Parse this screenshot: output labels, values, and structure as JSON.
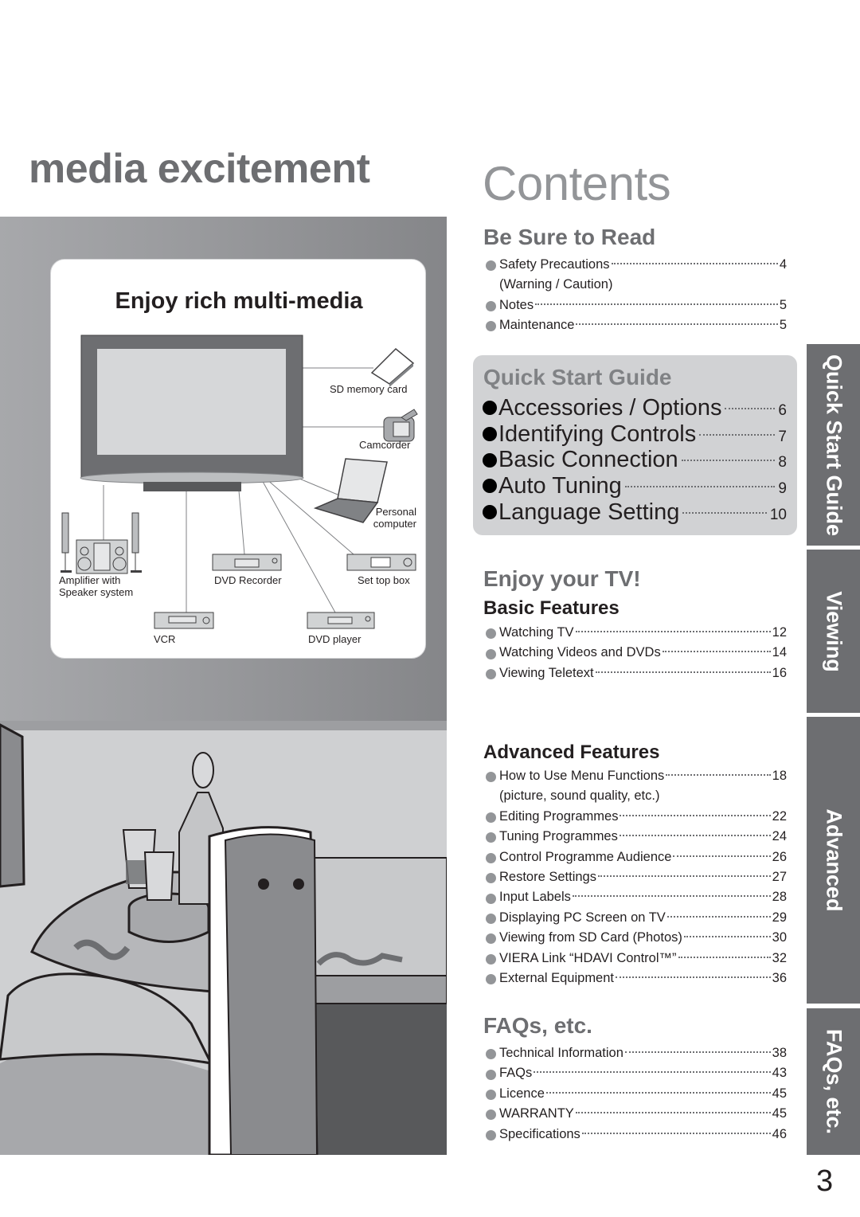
{
  "headline": "media excitement",
  "media_card": {
    "title": "Enjoy rich multi-media",
    "devices": [
      {
        "id": "sd-card",
        "label": "SD memory card"
      },
      {
        "id": "camcorder",
        "label": "Camcorder"
      },
      {
        "id": "personal-computer",
        "label": "Personal\ncomputer"
      },
      {
        "id": "amplifier",
        "label": "Amplifier with\nSpeaker system"
      },
      {
        "id": "dvd-recorder",
        "label": "DVD Recorder"
      },
      {
        "id": "set-top-box",
        "label": "Set top box"
      },
      {
        "id": "vcr",
        "label": "VCR"
      },
      {
        "id": "dvd-player",
        "label": "DVD player"
      }
    ]
  },
  "contents": {
    "title": "Contents",
    "be_sure_to_read": {
      "title": "Be Sure to Read",
      "items": [
        {
          "label": "Safety Precautions",
          "page": "4",
          "continuation": "(Warning / Caution)"
        },
        {
          "label": "Notes",
          "page": "5"
        },
        {
          "label": "Maintenance",
          "page": "5"
        }
      ]
    },
    "quick_start_guide": {
      "title": "Quick Start Guide",
      "items": [
        {
          "label": "Accessories / Options",
          "page": "6"
        },
        {
          "label": "Identifying Controls",
          "page": "7"
        },
        {
          "label": "Basic Connection",
          "page": "8"
        },
        {
          "label": "Auto Tuning",
          "page": "9"
        },
        {
          "label": "Language Setting",
          "page": "10"
        }
      ]
    },
    "enjoy_your_tv": {
      "title": "Enjoy your TV!",
      "basic_features": {
        "title": "Basic Features",
        "items": [
          {
            "label": "Watching TV",
            "page": "12"
          },
          {
            "label": "Watching Videos and DVDs",
            "page": "14"
          },
          {
            "label": "Viewing Teletext",
            "page": "16"
          }
        ]
      },
      "advanced_features": {
        "title": "Advanced Features",
        "items": [
          {
            "label": "How to Use Menu Functions",
            "page": "18",
            "continuation": "(picture, sound quality, etc.)"
          },
          {
            "label": "Editing Programmes",
            "page": "22"
          },
          {
            "label": "Tuning Programmes",
            "page": "24"
          },
          {
            "label": "Control Programme Audience",
            "page": "26"
          },
          {
            "label": "Restore Settings",
            "page": "27"
          },
          {
            "label": "Input Labels",
            "page": "28"
          },
          {
            "label": "Displaying PC Screen on TV",
            "page": "29"
          },
          {
            "label": "Viewing from SD Card (Photos)",
            "page": "30"
          },
          {
            "label": "VIERA Link “HDAVI Control™”",
            "page": "32"
          },
          {
            "label": "External Equipment",
            "page": "36"
          }
        ]
      }
    },
    "faqs": {
      "title": "FAQs, etc.",
      "items": [
        {
          "label": "Technical Information",
          "page": "38"
        },
        {
          "label": "FAQs",
          "page": "43"
        },
        {
          "label": "Licence",
          "page": "45"
        },
        {
          "label": "WARRANTY",
          "page": "45"
        },
        {
          "label": "Specifications",
          "page": "46"
        }
      ]
    }
  },
  "side_tabs": [
    "Quick Start Guide",
    "Viewing",
    "Advanced",
    "FAQs, etc."
  ],
  "page_number": "3",
  "colors": {
    "heading_gray": "#6d6e71",
    "light_gray": "#939598",
    "tab_gray": "#6d6e71",
    "box_gray": "#d1d2d4",
    "text": "#231f20"
  }
}
